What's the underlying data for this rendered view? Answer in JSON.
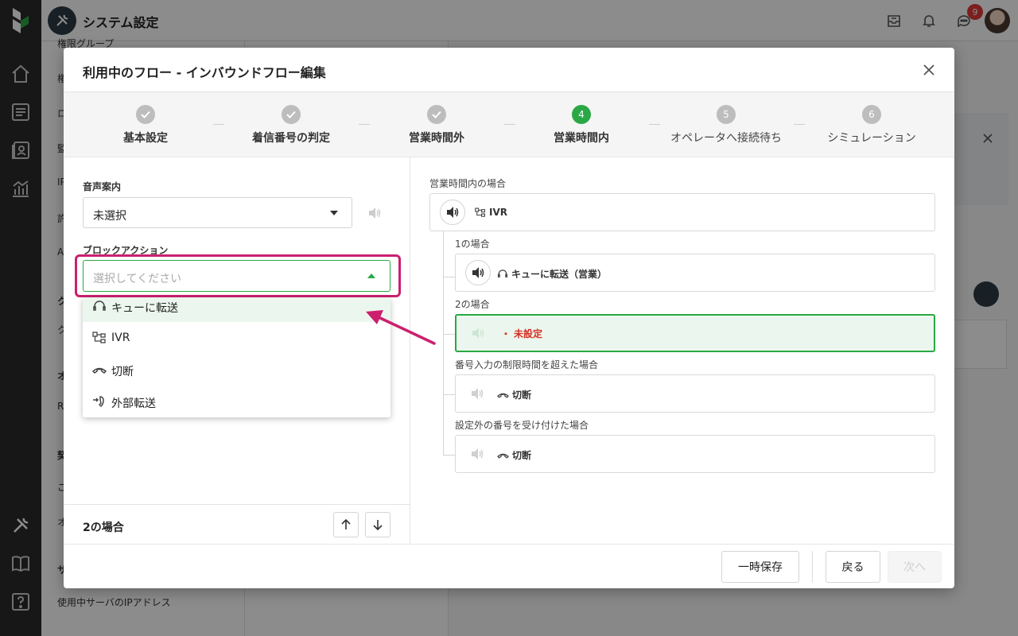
{
  "app": {
    "title": "システム設定",
    "notification_badge": "9"
  },
  "background": {
    "sidebar_items": [
      "権限グループ",
      "権",
      "ロ",
      "監",
      "IP",
      "許",
      "A",
      "ク",
      "ク",
      "オ",
      "R",
      "契",
      "ご",
      "オ",
      "サ",
      "使用中サーバのIPアドレス"
    ]
  },
  "modal": {
    "title": "利用中のフロー - インバウンドフロー編集",
    "steps": [
      {
        "num": "✓",
        "label": "基本設定",
        "state": "done"
      },
      {
        "num": "✓",
        "label": "着信番号の判定",
        "state": "done"
      },
      {
        "num": "✓",
        "label": "営業時間外",
        "state": "done"
      },
      {
        "num": "4",
        "label": "営業時間内",
        "state": "current"
      },
      {
        "num": "5",
        "label": "オペレータへ接続待ち",
        "state": "future"
      },
      {
        "num": "6",
        "label": "シミュレーション",
        "state": "future"
      }
    ],
    "left": {
      "voice_label": "音声案内",
      "voice_value": "未選択",
      "block_label": "ブロックアクション",
      "block_placeholder": "選択してください",
      "menu_items": [
        {
          "label": "キューに転送",
          "icon": "headset-icon"
        },
        {
          "label": "IVR",
          "icon": "ivr-icon"
        },
        {
          "label": "切断",
          "icon": "hangup-icon"
        },
        {
          "label": "外部転送",
          "icon": "external-transfer-icon"
        }
      ],
      "footer_title": "2の場合"
    },
    "right": {
      "heading": "営業時間内の場合",
      "root_label": "IVR",
      "branches": [
        {
          "caption": "1の場合",
          "label": "キューに転送（営業）",
          "icon": "headset-icon",
          "state": "normal"
        },
        {
          "caption": "2の場合",
          "label": "未設定",
          "icon": "dot",
          "state": "active"
        },
        {
          "caption": "番号入力の制限時間を超えた場合",
          "label": "切断",
          "icon": "hangup-icon",
          "state": "normal"
        },
        {
          "caption": "設定外の番号を受け付けた場合",
          "label": "切断",
          "icon": "hangup-icon",
          "state": "normal"
        }
      ]
    },
    "footer": {
      "save_label": "一時保存",
      "back_label": "戻る",
      "next_label": "次へ"
    }
  },
  "colors": {
    "accent_green": "#2aa845",
    "highlight_magenta": "#cc1f6e",
    "error_red": "#d93025"
  }
}
